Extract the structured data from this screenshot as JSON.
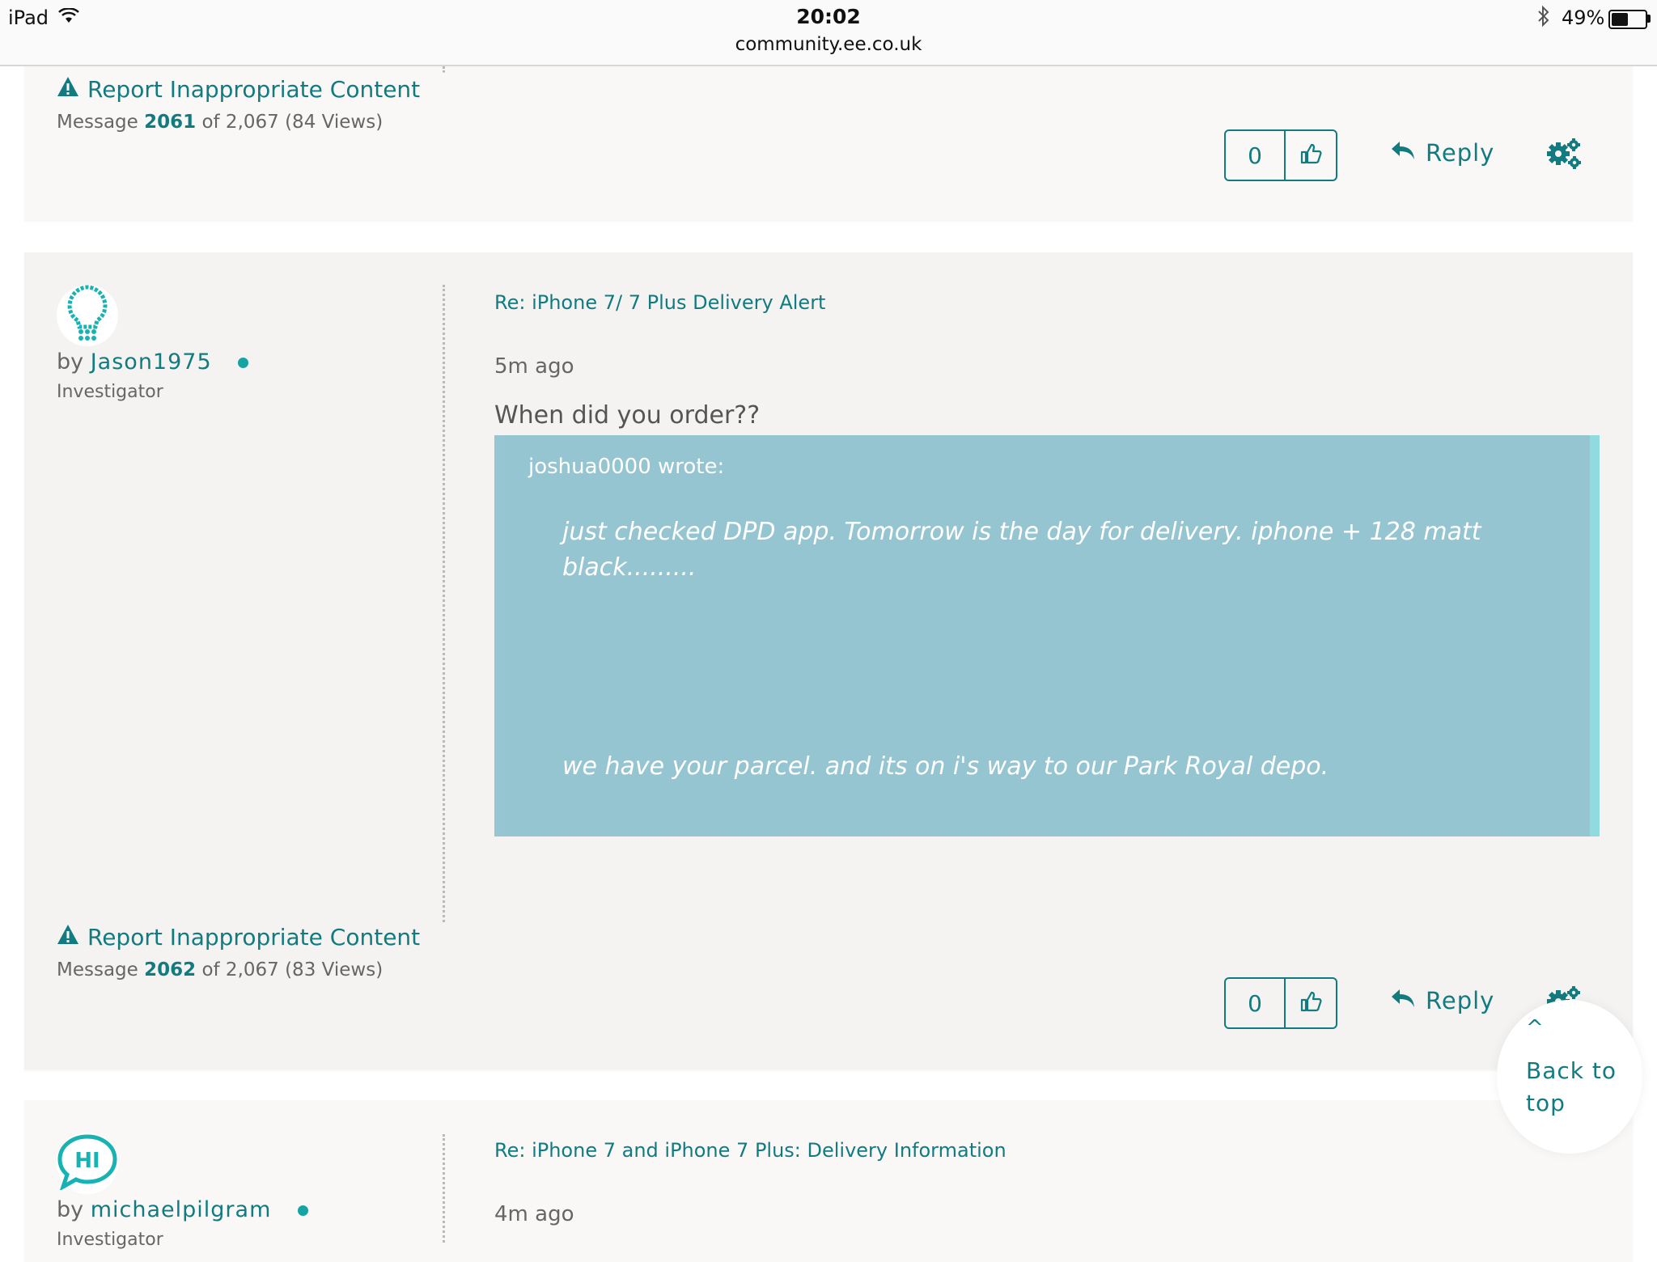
{
  "status_bar": {
    "device": "iPad",
    "time": "20:02",
    "url": "community.ee.co.uk",
    "battery_pct": "49%",
    "battery_level": 0.49
  },
  "posts": [
    {
      "report_label": "Report Inappropriate Content",
      "msg_prefix": "Message",
      "msg_number": "2061",
      "msg_suffix": "of 2,067 (84 Views)",
      "kudos_count": "0",
      "reply_label": "Reply"
    },
    {
      "by_label": "by",
      "author": "Jason1975",
      "rank": "Investigator",
      "subject": "Re: iPhone 7/ 7 Plus Delivery Alert",
      "time": "5m ago",
      "body": "When did you order??",
      "quote": {
        "author_line": "joshua0000 wrote:",
        "line1": "just checked DPD app. Tomorrow is the day for delivery. iphone + 128 matt black.........",
        "line2": "we have your parcel. and its on i's way to our Park Royal depo."
      },
      "report_label": "Report Inappropriate Content",
      "msg_prefix": "Message",
      "msg_number": "2062",
      "msg_suffix": "of 2,067 (83 Views)",
      "kudos_count": "0",
      "reply_label": "Reply"
    },
    {
      "by_label": "by",
      "author": "michaelpilgram",
      "rank": "Investigator",
      "subject": "Re: iPhone 7 and iPhone 7 Plus: Delivery Information",
      "time": "4m ago",
      "avatar_text": "HI"
    }
  ],
  "back_to_top": {
    "caret": "^",
    "label": "Back to top"
  },
  "colors": {
    "accent": "#117b80",
    "quote_bg": "#95c5d0",
    "online": "#16a3a3"
  }
}
